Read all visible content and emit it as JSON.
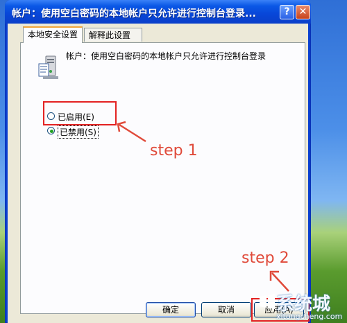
{
  "window": {
    "title": "帐户：使用空白密码的本地帐户只允许进行控制台登录...",
    "help_label": "?",
    "close_label": "✕"
  },
  "tabs": [
    {
      "label": "本地安全设置",
      "active": true
    },
    {
      "label": "解释此设置",
      "active": false
    }
  ],
  "policy": {
    "description": "帐户：使用空白密码的本地帐户只允许进行控制台登录",
    "icon": "policy-server-icon"
  },
  "options": [
    {
      "label": "已启用(E)",
      "selected": false
    },
    {
      "label": "已禁用(S)",
      "selected": true
    }
  ],
  "buttons": {
    "ok": "确定",
    "cancel": "取消",
    "apply": "应用(A)"
  },
  "annotations": {
    "step1": "step 1",
    "step2": "step 2"
  },
  "watermark": {
    "main": "系统城",
    "sub": "xitongcheng.com"
  },
  "colors": {
    "annotation": "#e04a3a",
    "highlight_border": "#e32121",
    "titlebar": "#0a58e6",
    "dialog_bg": "#ece9d8"
  }
}
